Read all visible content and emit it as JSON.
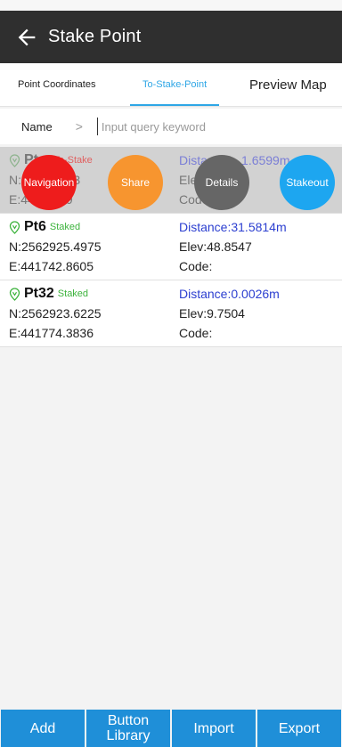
{
  "app": {
    "title": "Stake Point"
  },
  "tabs": [
    "Point Coordinates",
    "To-Stake-Point",
    "Preview Map"
  ],
  "search": {
    "label": "Name",
    "placeholder": "Input query keyword"
  },
  "rows": [
    {
      "name": "Pt...",
      "status": "To-Stake",
      "n": "N:2562...963",
      "e": "E:44...4319",
      "distance": "Distance:...1.6599m",
      "elev": "Elev:...9",
      "code": "Code:"
    },
    {
      "name": "Pt6",
      "status": "Staked",
      "n": "N:2562925.4975",
      "e": "E:441742.8605",
      "distance": "Distance:31.5814m",
      "elev": "Elev:48.8547",
      "code": "Code:"
    },
    {
      "name": "Pt32",
      "status": "Staked",
      "n": "N:2562923.6225",
      "e": "E:441774.3836",
      "distance": "Distance:0.0026m",
      "elev": "Elev:9.7504",
      "code": "Code:"
    }
  ],
  "actions": {
    "navigation": "Navigation",
    "share": "Share",
    "details": "Details",
    "stakeout": "Stakeout"
  },
  "bottom_buttons": [
    "Add",
    "Button Library",
    "Import",
    "Export"
  ],
  "colors": {
    "appbar": "#2f2f2f",
    "accent": "#2ea6e6",
    "staked": "#3db33d",
    "distance": "#2c3fd0",
    "bottom_button": "#1f8fd8"
  },
  "icons": {
    "back": "arrow-left-icon",
    "pin": "location-pin-icon",
    "chevron": "chevron-right-icon"
  }
}
